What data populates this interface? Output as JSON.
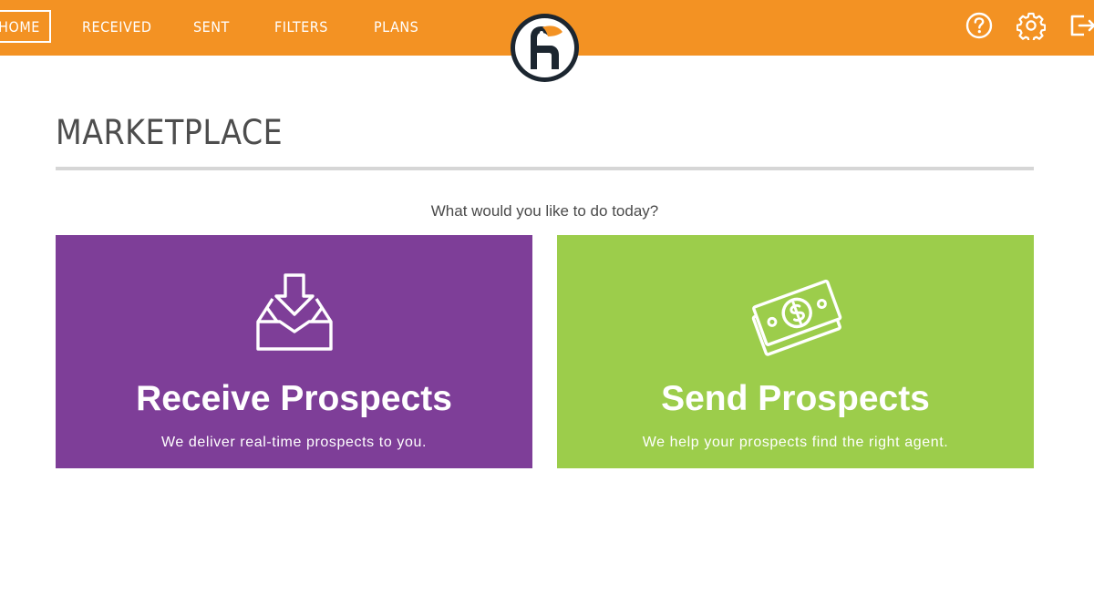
{
  "nav": {
    "home": "HOME",
    "received": "RECEIVED",
    "sent": "SENT",
    "filters": "FILTERS",
    "plans": "PLANS"
  },
  "header": {
    "logo_icon": "toucan-logo-icon",
    "help_icon": "help-circle-icon",
    "settings_icon": "gear-icon",
    "logout_icon": "logout-icon"
  },
  "main": {
    "title": "MARKETPLACE",
    "prompt": "What would you like to do today?"
  },
  "cards": {
    "receive": {
      "icon": "inbox-download-icon",
      "title": "Receive Prospects",
      "subtitle": "We deliver real-time prospects to you."
    },
    "send": {
      "icon": "money-bills-icon",
      "title": "Send Prospects",
      "subtitle": "We help your prospects find the right agent."
    }
  },
  "colors": {
    "header": "#f39223",
    "receive_card": "#7e3e98",
    "send_card": "#9ccd4b",
    "title_text": "#4d4d4d"
  }
}
